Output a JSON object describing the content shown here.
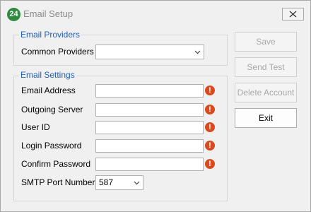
{
  "window": {
    "title": "Email Setup",
    "app_icon_text": "24"
  },
  "providers_group": {
    "title": "Email Providers",
    "common_providers_label": "Common Providers",
    "common_providers_value": ""
  },
  "settings_group": {
    "title": "Email Settings",
    "fields": {
      "email_address": {
        "label": "Email Address",
        "value": ""
      },
      "outgoing_server": {
        "label": "Outgoing Server",
        "value": ""
      },
      "user_id": {
        "label": "User ID",
        "value": ""
      },
      "login_password": {
        "label": "Login Password",
        "value": ""
      },
      "confirm_password": {
        "label": "Confirm Password",
        "value": ""
      }
    },
    "error_icon_glyph": "!",
    "smtp_port_label": "SMTP Port Number",
    "smtp_port_value": "587"
  },
  "buttons": {
    "save": "Save",
    "send_test": "Send Test",
    "delete_account": "Delete Account",
    "exit": "Exit"
  },
  "colors": {
    "group_title": "#1f5fb8",
    "error_icon": "#d94a1e",
    "app_icon": "#2e8b3e",
    "disabled_text": "#a8a8a8"
  }
}
